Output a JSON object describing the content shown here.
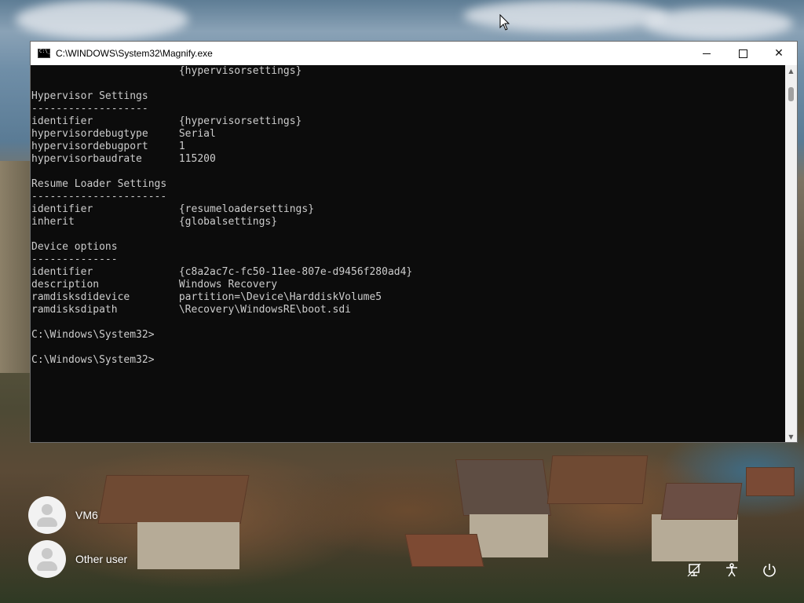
{
  "window": {
    "title": "C:\\WINDOWS\\System32\\Magnify.exe",
    "minimize_glyph": "—",
    "close_glyph": "✕"
  },
  "console": {
    "text": "                        {hypervisorsettings}\n\nHypervisor Settings\n-------------------\nidentifier              {hypervisorsettings}\nhypervisordebugtype     Serial\nhypervisordebugport     1\nhypervisorbaudrate      115200\n\nResume Loader Settings\n----------------------\nidentifier              {resumeloadersettings}\ninherit                 {globalsettings}\n\nDevice options\n--------------\nidentifier              {c8a2ac7c-fc50-11ee-807e-d9456f280ad4}\ndescription             Windows Recovery\nramdisksdidevice        partition=\\Device\\HarddiskVolume5\nramdisksdipath          \\Recovery\\WindowsRE\\boot.sdi\n\nC:\\Windows\\System32>\n\nC:\\Windows\\System32>"
  },
  "users": [
    {
      "name": "VM6"
    },
    {
      "name": "Other user"
    }
  ],
  "system_icons": [
    "network-icon",
    "accessibility-icon",
    "power-icon"
  ]
}
